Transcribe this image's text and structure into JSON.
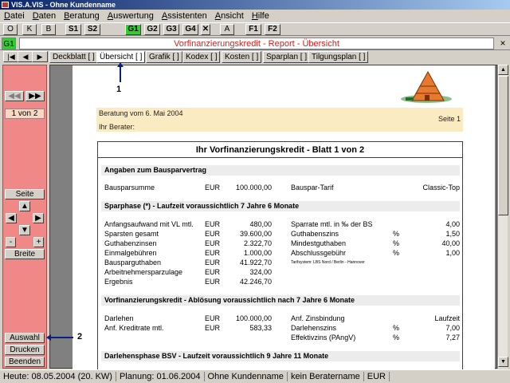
{
  "window": {
    "title": "VIS.A.VIS - Ohne Kundenname"
  },
  "menu": [
    "Datei",
    "Daten",
    "Beratung",
    "Auswertung",
    "Assistenten",
    "Ansicht",
    "Hilfe"
  ],
  "toolbar": [
    "O",
    "K",
    "B",
    "S1",
    "S2",
    "G1",
    "G2",
    "G3",
    "G4",
    "✕",
    "A",
    "F1",
    "F2"
  ],
  "doc": {
    "badge": "G1",
    "title": "Vorfinanzierungskredit - Report - Übersicht",
    "close": "×"
  },
  "tabs": [
    "Deckblatt [ ]",
    "Übersicht [ ]",
    "Grafik [ ]",
    "Kodex [ ]",
    "Kosten [ ]",
    "Sparplan [ ]",
    "Tilgungsplan [ ]"
  ],
  "sidebar": {
    "page_indicator": "1 von 2",
    "seite": "Seite",
    "minus": "-",
    "plus": "+",
    "breite": "Breite",
    "auswahl": "Auswahl",
    "drucken": "Drucken",
    "beenden": "Beenden"
  },
  "annotations": {
    "one": "1",
    "two": "2"
  },
  "header": {
    "beratung": "Beratung vom 6. Mai 2004",
    "berater": "Ihr Berater:",
    "seite": "Seite  1"
  },
  "report": {
    "title": "Ihr Vorfinanzierungskredit  -  Blatt 1 von 2",
    "sections": [
      {
        "title": "Angaben zum Bausparvertrag"
      },
      {
        "title": "Sparphase (*)  -  Laufzeit  voraussichtlich 7 Jahre 6 Monate"
      },
      {
        "title": "Vorfinanzierungskredit  -  Ablösung  voraussichtlich nach 7 Jahre 6 Monate"
      },
      {
        "title": "Darlehensphase BSV  -  Laufzeit  voraussichtlich 9 Jahre 11 Monate"
      }
    ],
    "bauspar": {
      "l1": "Bausparsumme",
      "u1": "EUR",
      "v1": "100.000,00",
      "l2": "Bauspar-Tarif",
      "v2": "Classic-Top"
    },
    "sparphase": [
      {
        "l1": "Anfangsaufwand mit VL mtl.",
        "u1": "EUR",
        "v1": "480,00",
        "l2": "Sparrate mtl. in ‰ der BS",
        "u2": "",
        "v2": "4,00"
      },
      {
        "l1": "Sparsten gesamt",
        "u1": "EUR",
        "v1": "39.600,00",
        "l2": "Guthabenszins",
        "u2": "%",
        "v2": "1,50"
      },
      {
        "l1": "Guthabenzinsen",
        "u1": "EUR",
        "v1": "2.322,70",
        "l2": "Mindestguthaben",
        "u2": "%",
        "v2": "40,00"
      },
      {
        "l1": "Einmalgebühren",
        "u1": "EUR",
        "v1": "1.000,00",
        "l2": "Abschlussgebühr",
        "u2": "%",
        "v2": "1,00"
      },
      {
        "l1": "Bausparguthaben",
        "u1": "EUR",
        "v1": "41.922,70",
        "l2": "",
        "u2": "",
        "v2": ""
      },
      {
        "l1": "Arbeitnehmersparzulage",
        "u1": "EUR",
        "v1": "324,00",
        "l2": "",
        "u2": "",
        "v2": ""
      },
      {
        "l1": "Ergebnis",
        "u1": "EUR",
        "v1": "42.246,70",
        "l2": "",
        "u2": "",
        "v2": ""
      }
    ],
    "tarif_note": "Tarifsystem: LBS Nord / Berlin - Hannover",
    "vorfin": [
      {
        "l1": "Darlehen",
        "u1": "EUR",
        "v1": "100.000,00",
        "l2": "Anf. Zinsbindung",
        "u2": "",
        "v2": "Laufzeit"
      },
      {
        "l1": "Anf. Kreditrate mtl.",
        "u1": "EUR",
        "v1": "583,33",
        "l2": "Darlehenszins",
        "u2": "%",
        "v2": "7,00"
      },
      {
        "l1": "",
        "u1": "",
        "v1": "",
        "l2": "Effektivzins (PAngV)",
        "u2": "%",
        "v2": "7,27"
      }
    ]
  },
  "statusbar": [
    "Heute: 08.05.2004 (20. KW)",
    "Planung: 01.06.2004",
    "Ohne Kundenname",
    "kein Beratername",
    "EUR"
  ]
}
